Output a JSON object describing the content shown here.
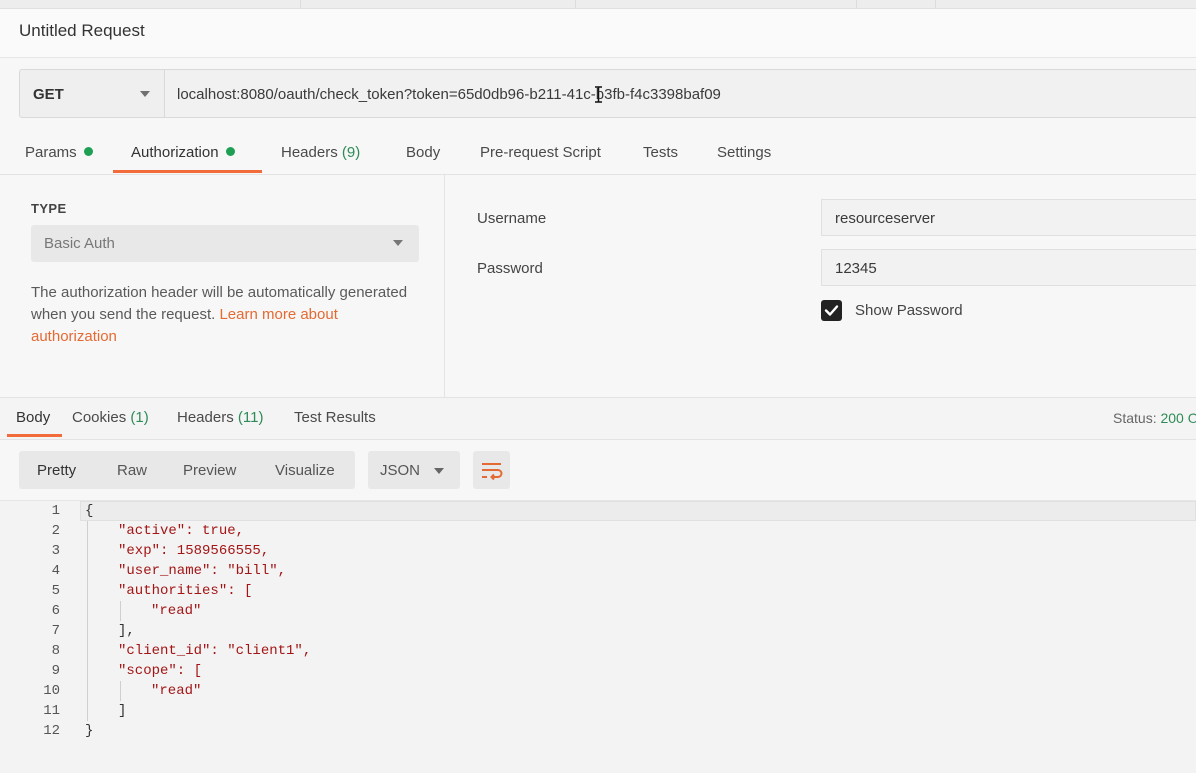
{
  "request": {
    "title": "Untitled Request",
    "method": "GET",
    "url": "localhost:8080/oauth/check_token?token=65d0db96-b211-41c-b3fb-f4c3398baf09"
  },
  "request_tabs": {
    "params": "Params",
    "authorization": "Authorization",
    "headers": "Headers",
    "headers_count": "(9)",
    "body": "Body",
    "prerequest": "Pre-request Script",
    "tests": "Tests",
    "settings": "Settings"
  },
  "auth": {
    "type_label": "TYPE",
    "type_value": "Basic Auth",
    "description": "The authorization header will be automatically generated when you send the request.",
    "learn_more_link": "Learn more about authorization",
    "username_label": "Username",
    "username_value": "resourceserver",
    "password_label": "Password",
    "password_value": "12345",
    "show_password_label": "Show Password",
    "show_password_checked": true
  },
  "response_tabs": {
    "body": "Body",
    "cookies": "Cookies",
    "cookies_count": "(1)",
    "headers": "Headers",
    "headers_count": "(11)",
    "test_results": "Test Results",
    "status_label": "Status:",
    "status_value": "200 O"
  },
  "view": {
    "pretty": "Pretty",
    "raw": "Raw",
    "preview": "Preview",
    "visualize": "Visualize",
    "format": "JSON"
  },
  "response_body": {
    "line_numbers": [
      "1",
      "2",
      "3",
      "4",
      "5",
      "6",
      "7",
      "8",
      "9",
      "10",
      "11",
      "12"
    ],
    "lines": [
      "{",
      "\"active\": true,",
      "\"exp\": 1589566555,",
      "\"user_name\": \"bill\",",
      "\"authorities\": [",
      "\"read\"",
      "],",
      "\"client_id\": \"client1\",",
      "\"scope\": [",
      "\"read\"",
      "]",
      "}"
    ]
  },
  "colors": {
    "accent": "#f26b3a",
    "status_ok": "#2e8b57",
    "dot_green": "#1e9f53",
    "json_key": "#a31515",
    "json_value": "#0b3b8c"
  }
}
